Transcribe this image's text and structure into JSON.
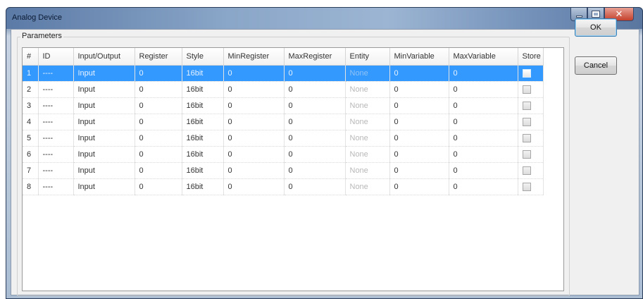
{
  "window": {
    "title": "Analog Device"
  },
  "group": {
    "label": "Parameters"
  },
  "table": {
    "columns": [
      "#",
      "ID",
      "Input/Output",
      "Register",
      "Style",
      "MinRegister",
      "MaxRegister",
      "Entity",
      "MinVariable",
      "MaxVariable",
      "Store"
    ],
    "rows": [
      {
        "num": "1",
        "id": "----",
        "io": "Input",
        "register": "0",
        "style": "16bit",
        "minreg": "0",
        "maxreg": "0",
        "entity": "None",
        "minvar": "0",
        "maxvar": "0",
        "store": false,
        "selected": true
      },
      {
        "num": "2",
        "id": "----",
        "io": "Input",
        "register": "0",
        "style": "16bit",
        "minreg": "0",
        "maxreg": "0",
        "entity": "None",
        "minvar": "0",
        "maxvar": "0",
        "store": false,
        "selected": false
      },
      {
        "num": "3",
        "id": "----",
        "io": "Input",
        "register": "0",
        "style": "16bit",
        "minreg": "0",
        "maxreg": "0",
        "entity": "None",
        "minvar": "0",
        "maxvar": "0",
        "store": false,
        "selected": false
      },
      {
        "num": "4",
        "id": "----",
        "io": "Input",
        "register": "0",
        "style": "16bit",
        "minreg": "0",
        "maxreg": "0",
        "entity": "None",
        "minvar": "0",
        "maxvar": "0",
        "store": false,
        "selected": false
      },
      {
        "num": "5",
        "id": "----",
        "io": "Input",
        "register": "0",
        "style": "16bit",
        "minreg": "0",
        "maxreg": "0",
        "entity": "None",
        "minvar": "0",
        "maxvar": "0",
        "store": false,
        "selected": false
      },
      {
        "num": "6",
        "id": "----",
        "io": "Input",
        "register": "0",
        "style": "16bit",
        "minreg": "0",
        "maxreg": "0",
        "entity": "None",
        "minvar": "0",
        "maxvar": "0",
        "store": false,
        "selected": false
      },
      {
        "num": "7",
        "id": "----",
        "io": "Input",
        "register": "0",
        "style": "16bit",
        "minreg": "0",
        "maxreg": "0",
        "entity": "None",
        "minvar": "0",
        "maxvar": "0",
        "store": false,
        "selected": false
      },
      {
        "num": "8",
        "id": "----",
        "io": "Input",
        "register": "0",
        "style": "16bit",
        "minreg": "0",
        "maxreg": "0",
        "entity": "None",
        "minvar": "0",
        "maxvar": "0",
        "store": false,
        "selected": false
      }
    ]
  },
  "buttons": {
    "ok": "OK",
    "cancel": "Cancel"
  },
  "colors": {
    "selection": "#3399ff",
    "title_bar": "#8aa6c8",
    "close": "#c4402c"
  },
  "icons": {
    "minimize": "minimize-icon",
    "maximize": "maximize-icon",
    "close": "close-icon"
  }
}
